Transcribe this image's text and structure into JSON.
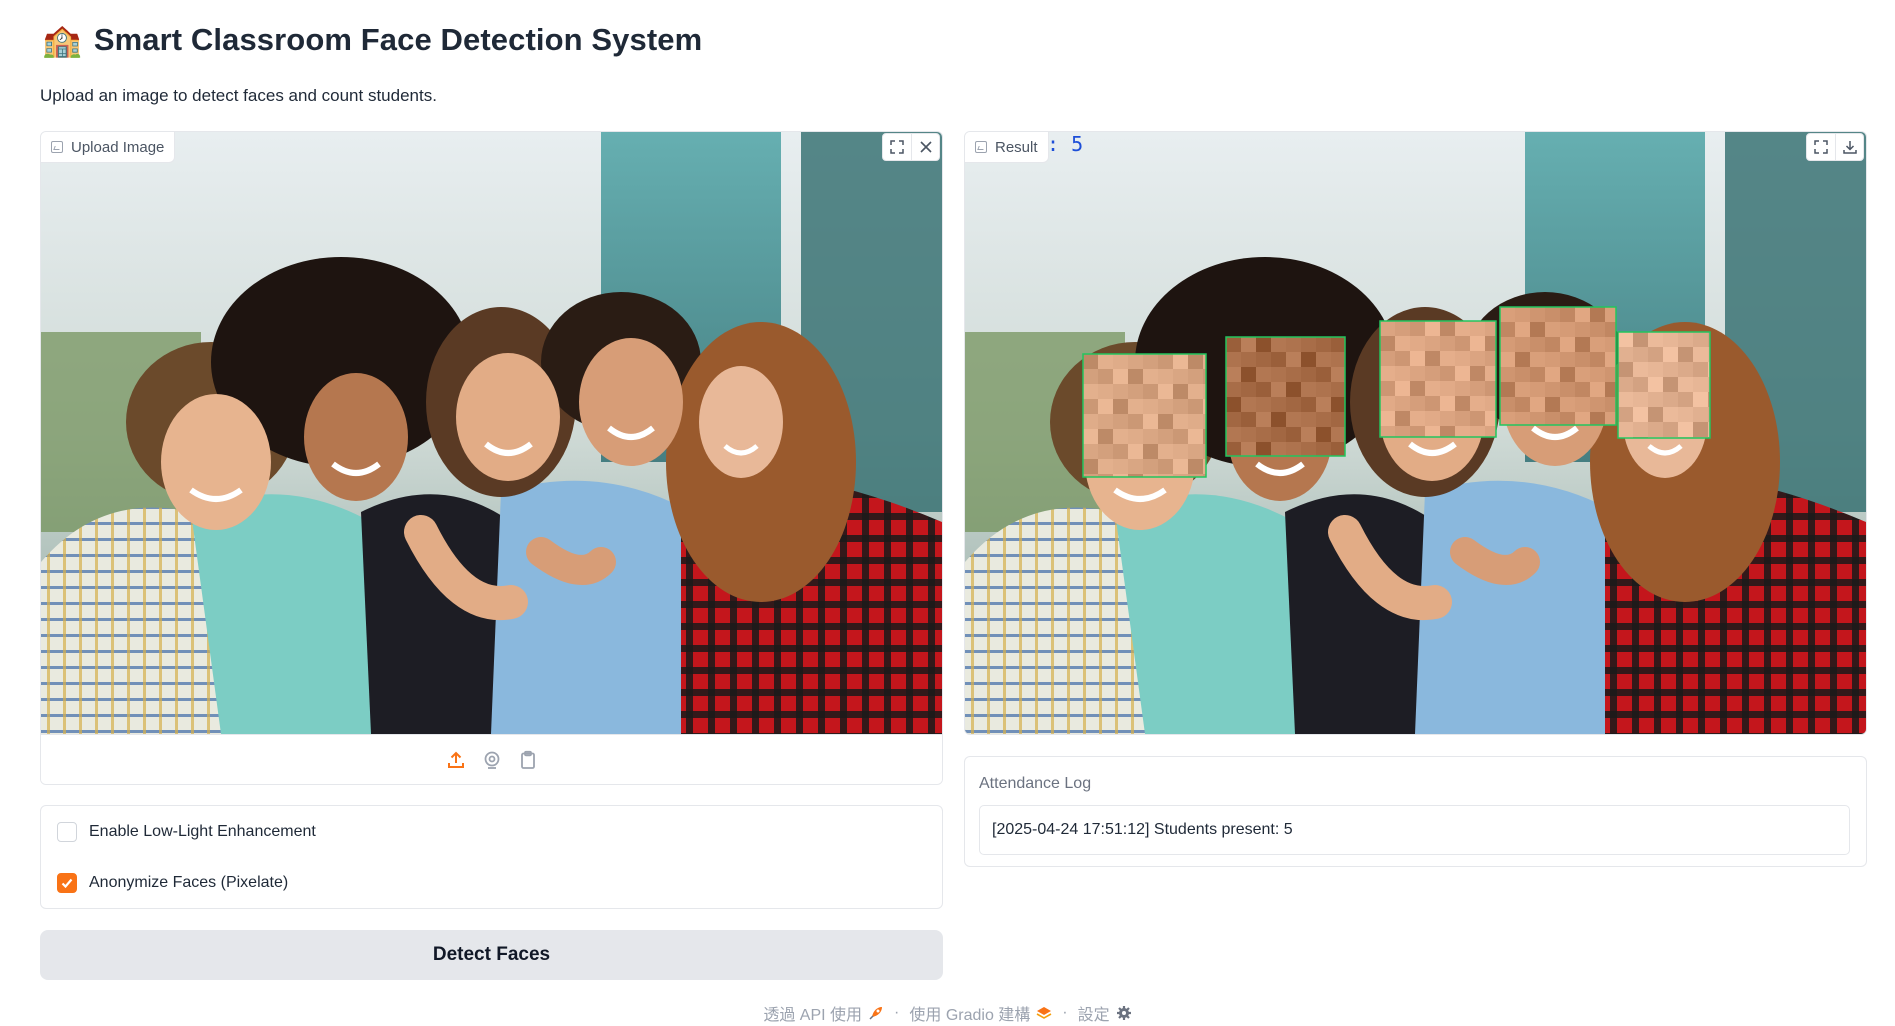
{
  "header": {
    "emoji": "🏫",
    "title": "Smart Classroom Face Detection System",
    "subtitle": "Upload an image to detect faces and count students."
  },
  "input_image": {
    "label": "Upload Image",
    "tools": [
      "fullscreen-icon",
      "close-icon"
    ],
    "sources": [
      "upload-icon",
      "webcam-icon",
      "clipboard-icon"
    ]
  },
  "options": {
    "low_light": {
      "label": "Enable Low-Light Enhancement",
      "checked": false
    },
    "anonymize": {
      "label": "Anonymize Faces (Pixelate)",
      "checked": true
    }
  },
  "detect_button": {
    "label": "Detect Faces"
  },
  "result_image": {
    "label": "Result",
    "overlay_text": ": 5",
    "faces_detected": 5,
    "tools": [
      "fullscreen-icon",
      "download-icon"
    ]
  },
  "attendance": {
    "label": "Attendance Log",
    "value": "[2025-04-24 17:51:12] Students present: 5"
  },
  "footer": {
    "api_link": "透過 API 使用",
    "built_with": "使用 Gradio 建構",
    "settings": "設定"
  },
  "colors": {
    "accent": "#f97316",
    "detection_box": "#22c55e",
    "count_text": "#1d4ed8"
  }
}
